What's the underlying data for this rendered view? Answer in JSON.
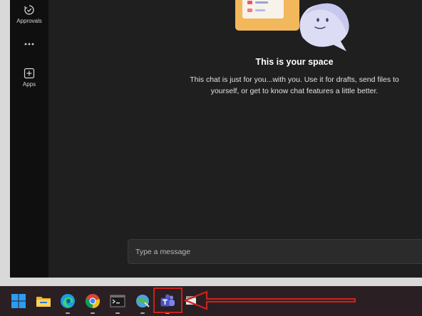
{
  "rail": {
    "items": [
      {
        "id": "approvals",
        "label": "Approvals",
        "icon": "approvals-icon"
      },
      {
        "id": "more",
        "label": "",
        "icon": "more-icon"
      },
      {
        "id": "apps",
        "label": "Apps",
        "icon": "apps-icon"
      }
    ]
  },
  "chat": {
    "title": "This is your space",
    "body": "This chat is just for you...with you. Use it for drafts, send files to yourself, or get to know chat features a little better.",
    "compose_placeholder": "Type a message"
  },
  "taskbar": {
    "items": [
      {
        "name": "start-icon",
        "running": false
      },
      {
        "name": "file-explorer-icon",
        "running": false
      },
      {
        "name": "edge-icon",
        "running": true
      },
      {
        "name": "chrome-icon",
        "running": true
      },
      {
        "name": "terminal-icon",
        "running": true
      },
      {
        "name": "control-panel-icon",
        "running": true
      },
      {
        "name": "teams-icon",
        "running": true,
        "highlighted": true
      },
      {
        "name": "app-icon",
        "running": false
      }
    ]
  },
  "colors": {
    "rail_bg": "#0f0f0f",
    "chat_bg": "#1f1f1f",
    "compose_bg": "#2b2b2b",
    "taskbar_bg": "#2a1f22",
    "highlight": "#c8221c",
    "teams_purple": "#5b5fc7"
  }
}
